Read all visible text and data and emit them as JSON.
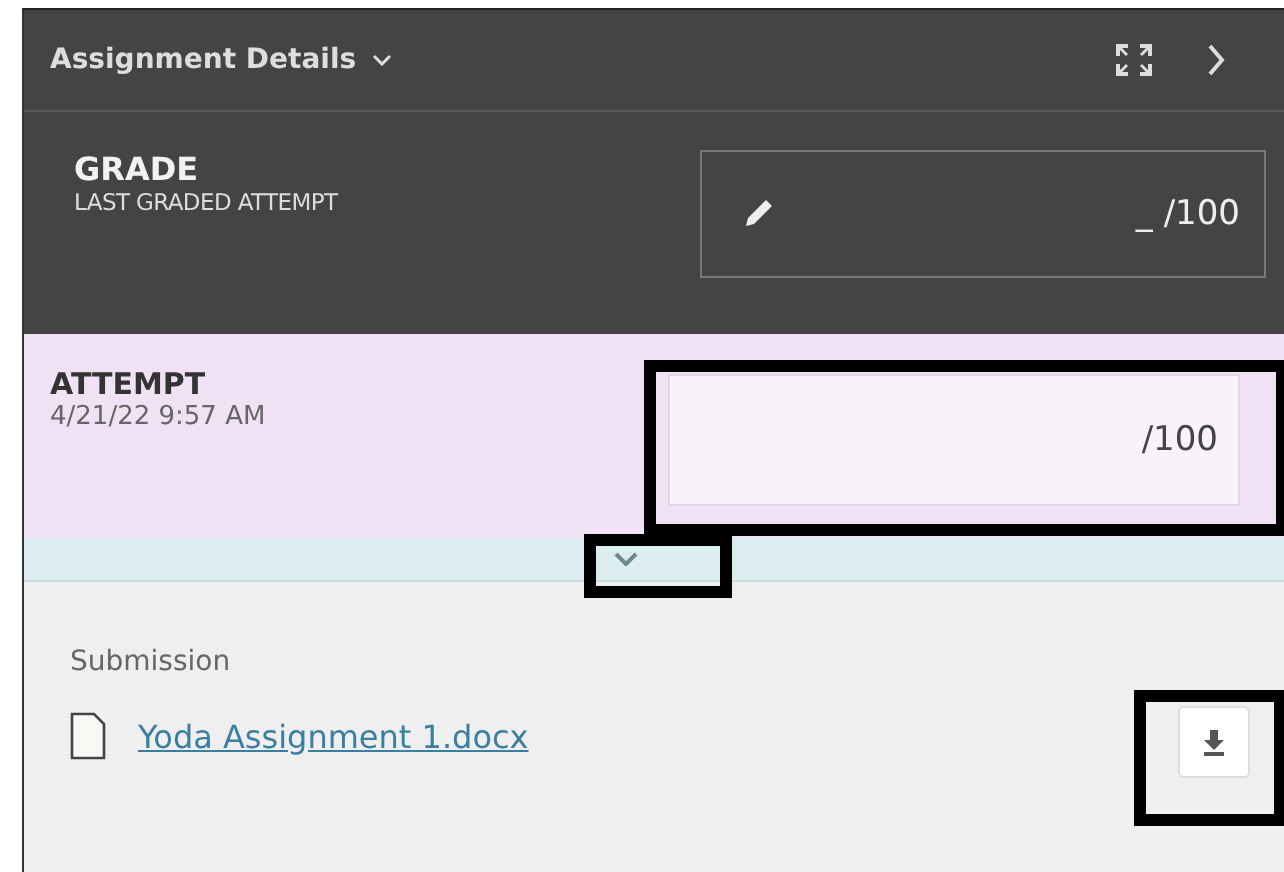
{
  "header": {
    "title": "Assignment Details"
  },
  "grade": {
    "label": "GRADE",
    "sublabel": "LAST GRADED ATTEMPT",
    "value": "_",
    "out_of": "/100"
  },
  "attempt": {
    "label": "ATTEMPT",
    "date": "4/21/22 9:57 AM",
    "out_of": "/100",
    "highlighted": true
  },
  "expand_toggle": {
    "highlighted": true,
    "expanded": false
  },
  "submission": {
    "label": "Submission",
    "file": "Yoda Assignment 1.docx",
    "download_highlighted": true
  }
}
